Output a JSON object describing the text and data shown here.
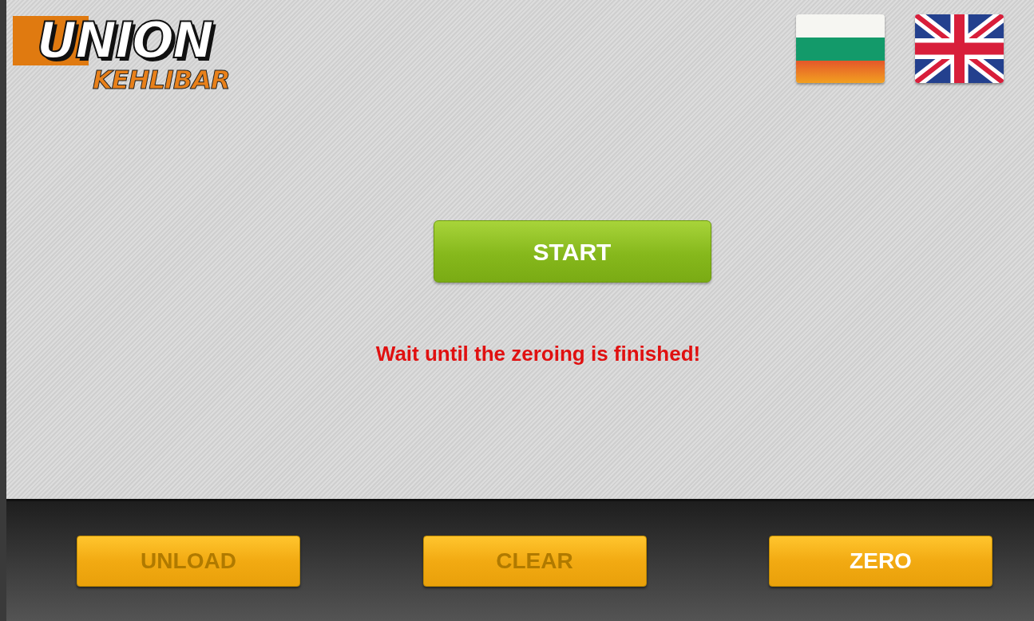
{
  "logo": {
    "line_1": "UNION",
    "line_2": "KEHLIBAR"
  },
  "languages": [
    {
      "kind": "bulgarian"
    },
    {
      "kind": "british"
    }
  ],
  "start_button": {
    "label": "START"
  },
  "message": "Wait until the zeroing is finished!",
  "buttons": [
    {
      "label": "UNLOAD",
      "disabled": true
    },
    {
      "label": "CLEAR",
      "disabled": true
    },
    {
      "label": "ZERO",
      "disabled": false
    }
  ]
}
